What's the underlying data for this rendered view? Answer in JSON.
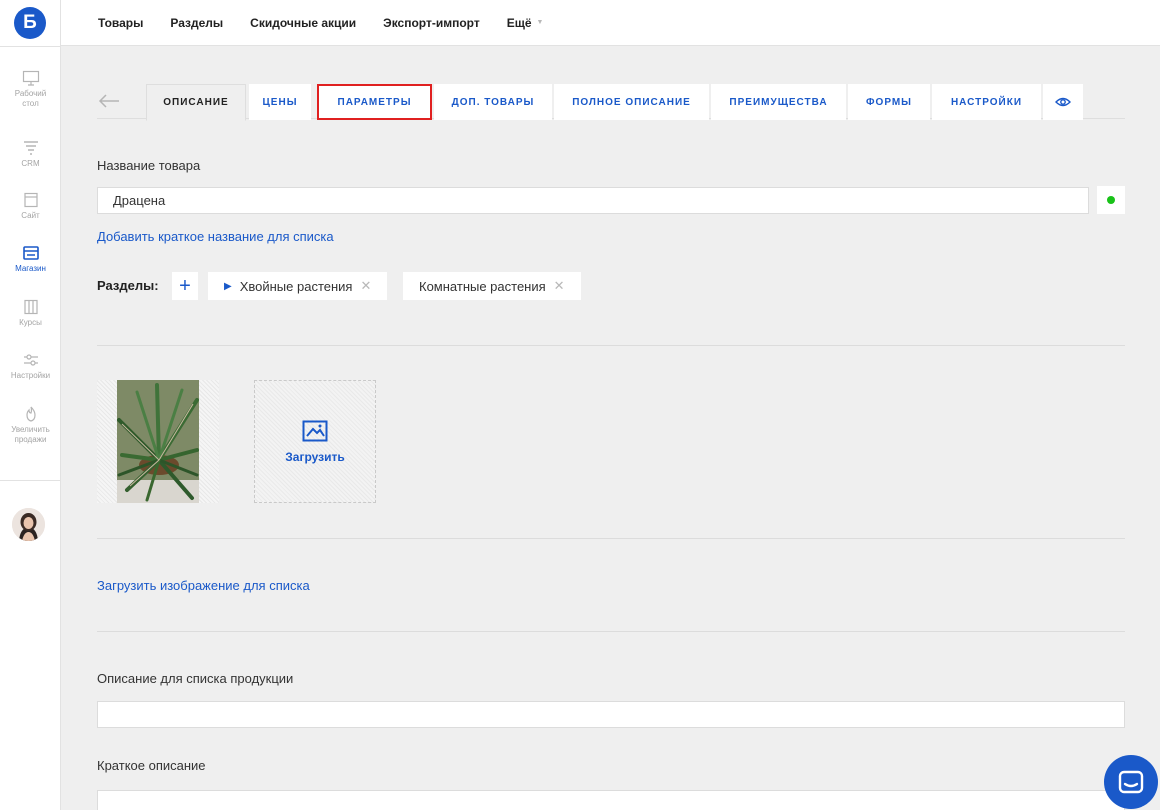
{
  "brand": {
    "logo_letter": "Б",
    "accent": "#1a59c9",
    "highlight": "#e02020",
    "status_ok": "#19c219"
  },
  "sidebar": {
    "items": [
      {
        "id": "desktop",
        "label_lines": [
          "Рабочий",
          "стол"
        ],
        "icon": "monitor-icon"
      },
      {
        "id": "crm",
        "label_lines": [
          "CRM"
        ],
        "icon": "funnel-icon"
      },
      {
        "id": "site",
        "label_lines": [
          "Сайт"
        ],
        "icon": "pages-icon"
      },
      {
        "id": "shop",
        "label_lines": [
          "Магазин"
        ],
        "icon": "cart-icon",
        "active": true
      },
      {
        "id": "courses",
        "label_lines": [
          "Курсы"
        ],
        "icon": "book-icon"
      },
      {
        "id": "settings",
        "label_lines": [
          "Настройки"
        ],
        "icon": "sliders-icon"
      },
      {
        "id": "boost",
        "label_lines": [
          "Увеличить",
          "продажи"
        ],
        "icon": "flame-icon"
      }
    ]
  },
  "topnav": {
    "links": [
      "Товары",
      "Разделы",
      "Скидочные акции",
      "Экспорт-импорт"
    ],
    "more_label": "Ещё"
  },
  "tabs": [
    {
      "label": "ОПИСАНИЕ",
      "active": true
    },
    {
      "label": "ЦЕНЫ"
    },
    {
      "label": "ПАРАМЕТРЫ",
      "highlighted": true
    },
    {
      "label": "ДОП. ТОВАРЫ"
    },
    {
      "label": "ПОЛНОЕ ОПИСАНИЕ"
    },
    {
      "label": "ПРЕИМУЩЕСТВА"
    },
    {
      "label": "ФОРМЫ"
    },
    {
      "label": "НАСТРОЙКИ"
    }
  ],
  "form": {
    "name_label": "Название товара",
    "name_value": "Драцена",
    "short_name_link": "Добавить краткое название для списка",
    "sections_label": "Разделы:",
    "sections": [
      {
        "label": "Хвойные растения",
        "primary": true
      },
      {
        "label": "Комнатные растения",
        "primary": false
      }
    ],
    "upload_label": "Загрузить",
    "list_image_link": "Загрузить изображение для списка",
    "list_description_label": "Описание для списка продукции",
    "list_description_value": "",
    "short_description_label": "Краткое описание"
  }
}
